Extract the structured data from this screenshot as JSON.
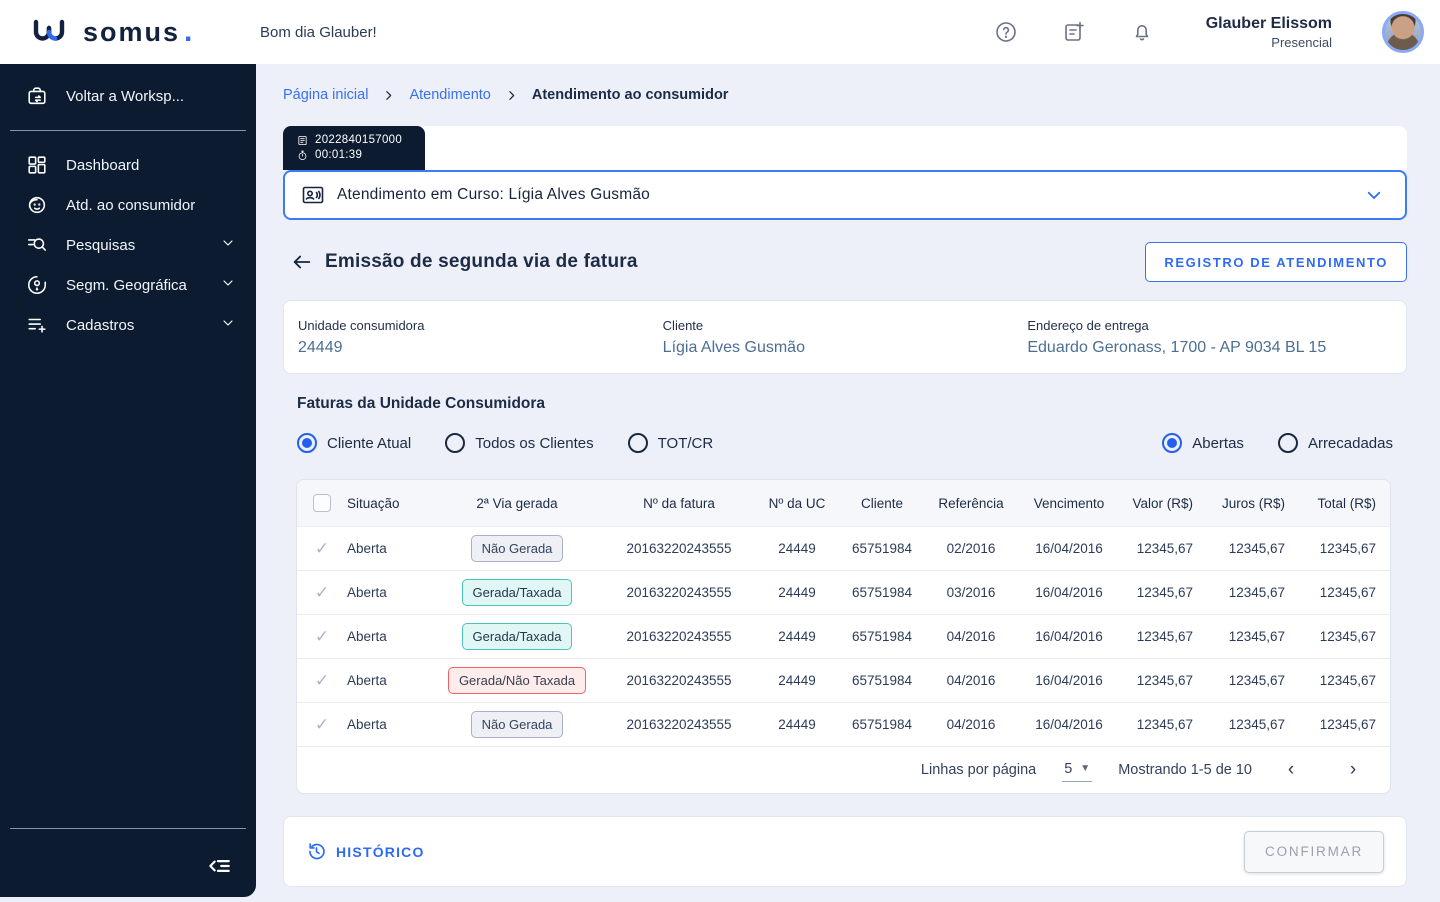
{
  "brand": {
    "logo_text": "SOMUS",
    "logo_dot": ".",
    "accent_color": "#2f6bf2",
    "navy_color": "#0c1b30"
  },
  "topbar": {
    "greeting": "Bom dia Glauber!",
    "user": {
      "name": "Glauber Elissom",
      "mode": "Presencial"
    },
    "icons": [
      "help-icon",
      "note-add-icon",
      "bell-icon"
    ]
  },
  "sidebar": {
    "workspace_item": {
      "label": "Voltar a Worksp...",
      "icon": "briefcase"
    },
    "items": [
      {
        "id": "dashboard",
        "label": "Dashboard",
        "icon": "dashboard",
        "expandable": false
      },
      {
        "id": "atd-consumidor",
        "label": "Atd. ao consumidor",
        "icon": "consumer",
        "expandable": false
      },
      {
        "id": "pesquisas",
        "label": "Pesquisas",
        "icon": "searchlines",
        "expandable": true
      },
      {
        "id": "segm-geografica",
        "label": "Segm. Geográfica",
        "icon": "geo",
        "expandable": true
      },
      {
        "id": "cadastros",
        "label": "Cadastros",
        "icon": "listplus",
        "expandable": true
      }
    ]
  },
  "breadcrumb": [
    {
      "label": "Página inicial",
      "link": true
    },
    {
      "label": "Atendimento",
      "link": true
    },
    {
      "label": "Atendimento ao consumidor",
      "link": false
    }
  ],
  "session_tab": {
    "protocol": "2022840157000",
    "timer": "00:01:39"
  },
  "attendance_bar": {
    "label": "Atendimento em Curso: Lígia Alves Gusmão"
  },
  "page": {
    "title": "Emissão de segunda via de fatura",
    "action_button": "REGISTRO DE ATENDIMENTO"
  },
  "consumer_info": {
    "fields": [
      {
        "label": "Unidade consumidora",
        "value": "24449"
      },
      {
        "label": "Cliente",
        "value": "Lígia Alves Gusmão"
      },
      {
        "label": "Endereço de entrega",
        "value": "Eduardo Geronass, 1700 - AP 9034 BL 15"
      }
    ]
  },
  "invoices": {
    "section_title": "Faturas da Unidade Consumidora",
    "client_filter": [
      {
        "label": "Cliente Atual",
        "selected": true
      },
      {
        "label": "Todos os Clientes",
        "selected": false
      },
      {
        "label": "TOT/CR",
        "selected": false
      }
    ],
    "status_filter": [
      {
        "label": "Abertas",
        "selected": true
      },
      {
        "label": "Arrecadadas",
        "selected": false
      }
    ]
  },
  "table": {
    "columns": [
      "",
      "Situação",
      "2ª Via gerada",
      "Nº da fatura",
      "Nº da UC",
      "Cliente",
      "Referência",
      "Vencimento",
      "Valor (R$)",
      "Juros (R$)",
      "Total (R$)"
    ],
    "rows": [
      {
        "selected": true,
        "situacao": "Aberta",
        "via_gerada": "Não Gerada",
        "via_status": "gray",
        "fatura": "20163220243555",
        "uc": "24449",
        "cliente": "65751984",
        "referencia": "02/2016",
        "vencimento": "16/04/2016",
        "valor": "12345,67",
        "juros": "12345,67",
        "total": "12345,67"
      },
      {
        "selected": true,
        "situacao": "Aberta",
        "via_gerada": "Gerada/Taxada",
        "via_status": "teal",
        "fatura": "20163220243555",
        "uc": "24449",
        "cliente": "65751984",
        "referencia": "03/2016",
        "vencimento": "16/04/2016",
        "valor": "12345,67",
        "juros": "12345,67",
        "total": "12345,67"
      },
      {
        "selected": true,
        "situacao": "Aberta",
        "via_gerada": "Gerada/Taxada",
        "via_status": "teal",
        "fatura": "20163220243555",
        "uc": "24449",
        "cliente": "65751984",
        "referencia": "04/2016",
        "vencimento": "16/04/2016",
        "valor": "12345,67",
        "juros": "12345,67",
        "total": "12345,67"
      },
      {
        "selected": true,
        "situacao": "Aberta",
        "via_gerada": "Gerada/Não Taxada",
        "via_status": "red",
        "fatura": "20163220243555",
        "uc": "24449",
        "cliente": "65751984",
        "referencia": "04/2016",
        "vencimento": "16/04/2016",
        "valor": "12345,67",
        "juros": "12345,67",
        "total": "12345,67"
      },
      {
        "selected": true,
        "situacao": "Aberta",
        "via_gerada": "Não Gerada",
        "via_status": "gray",
        "fatura": "20163220243555",
        "uc": "24449",
        "cliente": "65751984",
        "referencia": "04/2016",
        "vencimento": "16/04/2016",
        "valor": "12345,67",
        "juros": "12345,67",
        "total": "12345,67"
      }
    ],
    "pagination": {
      "rows_label": "Linhas por página",
      "page_size": "5",
      "showing": "Mostrando 1-5 de 10",
      "prev": "‹",
      "next": "›"
    }
  },
  "footer": {
    "history_label": "HISTÓRICO",
    "confirm_label": "CONFIRMAR"
  },
  "badge_colors": {
    "gray": "#a9b2c4",
    "teal": "#4dc3bd",
    "red": "#ef6461"
  }
}
